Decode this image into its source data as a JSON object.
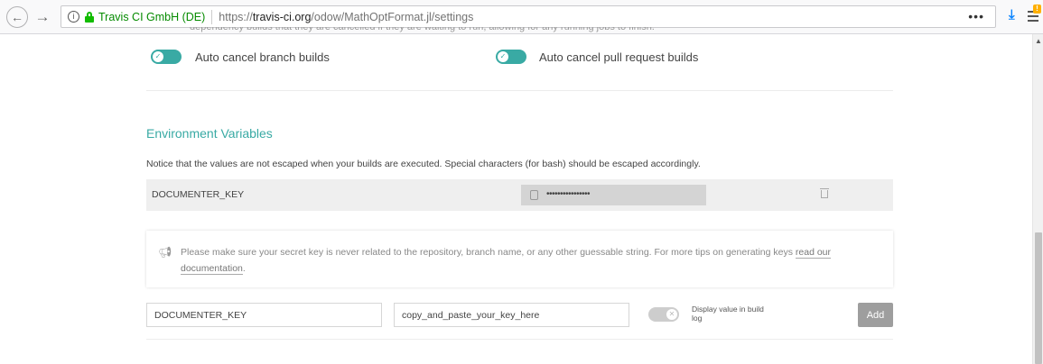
{
  "browser": {
    "back_glyph": "←",
    "forward_glyph": "→",
    "info_glyph": "i",
    "org_name": "Travis CI GmbH (DE)",
    "url_prefix": "https://",
    "url_domain": "travis-ci.org",
    "url_path": "/odow/MathOptFormat.jl/settings",
    "more_glyph": "•••",
    "download_glyph": "⤓",
    "badge_text": "!"
  },
  "auto_cancel": {
    "clipped_text": "dependency builds that they are cancelled if they are waiting to run, allowing for any running jobs to finish.",
    "branch_label": "Auto cancel branch builds",
    "branch_on": true,
    "pr_label": "Auto cancel pull request builds",
    "pr_on": true,
    "check_glyph": "✓"
  },
  "env_vars": {
    "title": "Environment Variables",
    "notice": "Notice that the values are not escaped when your builds are executed. Special characters (for bash) should be escaped accordingly.",
    "rows": [
      {
        "name": "DOCUMENTER_KEY",
        "masked_value": "••••••••••••••••"
      }
    ],
    "tip_text": "Please make sure your secret key is never related to the repository, branch name, or any other guessable string. For more tips on generating keys ",
    "tip_link": "read our documentation",
    "tip_end": ".",
    "form": {
      "name_value": "DOCUMENTER_KEY",
      "value_value": "copy_and_paste_your_key_here",
      "display_label": "Display value in build log",
      "display_on": false,
      "add_label": "Add",
      "x_glyph": "✕"
    }
  },
  "colors": {
    "accent": "#39aaa4",
    "secure_green": "#12bc00",
    "button_gray": "#9e9e9e"
  },
  "icons": [
    "back-icon",
    "forward-icon",
    "info-icon",
    "lock-icon",
    "more-icon",
    "download-icon",
    "library-icon",
    "lock-icon",
    "trash-icon",
    "megaphone-icon"
  ]
}
